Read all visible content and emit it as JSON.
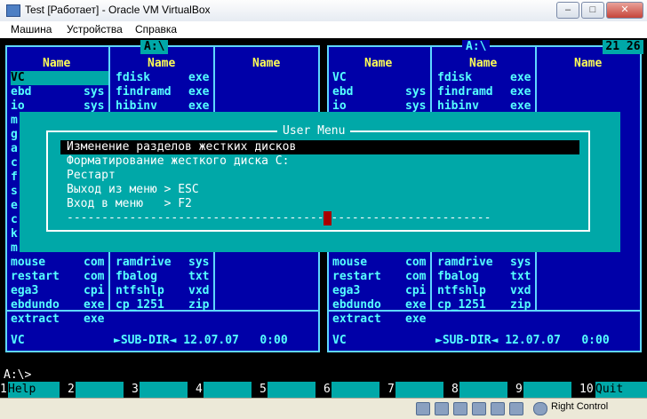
{
  "window": {
    "title": "Test [Работает] - Oracle VM VirtualBox"
  },
  "menubar": [
    "Машина",
    "Устройства",
    "Справка"
  ],
  "clock": "21 26",
  "left_panel": {
    "path": "A:\\",
    "headers": [
      "Name",
      "Name",
      "Name"
    ],
    "col1_top": [
      [
        "VC",
        ""
      ],
      [
        "ebd",
        "sys"
      ],
      [
        "io",
        "sys"
      ]
    ],
    "col1_letters": [
      "m",
      "g",
      "a",
      "c",
      "f",
      "s",
      "e",
      "c",
      "k",
      "m"
    ],
    "col2_top": [
      [
        "fdisk",
        "exe"
      ],
      [
        "findramd",
        "exe"
      ],
      [
        "hibinv",
        "exe"
      ]
    ],
    "col1_bottom": [
      [
        "mouse",
        "com"
      ],
      [
        "restart",
        "com"
      ],
      [
        "ega3",
        "cpi"
      ],
      [
        "ebdundo",
        "exe"
      ],
      [
        "extract",
        "exe"
      ]
    ],
    "col2_bottom": [
      [
        "ramdrive",
        "sys"
      ],
      [
        "fbalog",
        "txt"
      ],
      [
        "ntfshlp",
        "vxd"
      ],
      [
        "cp_1251",
        "zip"
      ]
    ],
    "footer_name": "VC",
    "footer_info": "►SUB-DIR◄ 12.07.07   0:00"
  },
  "right_panel": {
    "path": "A:\\",
    "headers": [
      "Name",
      "Name",
      "Name"
    ],
    "col1_top": [
      [
        "VC",
        ""
      ],
      [
        "ebd",
        "sys"
      ],
      [
        "io",
        "sys"
      ]
    ],
    "col2_top": [
      [
        "fdisk",
        "exe"
      ],
      [
        "findramd",
        "exe"
      ],
      [
        "hibinv",
        "exe"
      ]
    ],
    "col1_bottom": [
      [
        "mouse",
        "com"
      ],
      [
        "restart",
        "com"
      ],
      [
        "ega3",
        "cpi"
      ],
      [
        "ebdundo",
        "exe"
      ],
      [
        "extract",
        "exe"
      ]
    ],
    "col2_bottom": [
      [
        "ramdrive",
        "sys"
      ],
      [
        "fbalog",
        "txt"
      ],
      [
        "ntfshlp",
        "vxd"
      ],
      [
        "cp_1251",
        "zip"
      ]
    ],
    "footer_name": "VC",
    "footer_info": "►SUB-DIR◄ 12.07.07   0:00"
  },
  "user_menu": {
    "title": "User Menu",
    "items": [
      "Изменение разделов жестких дисков",
      "Форматирование жесткого диска C:",
      "Рестарт",
      "Выход из меню > ESC",
      "Вход в меню   > F2"
    ],
    "selected_index": 0,
    "divider": "----------------------------------------------------------------"
  },
  "prompt": "A:\\>",
  "fkeys": [
    {
      "num": "1",
      "label": "Help"
    },
    {
      "num": "2",
      "label": ""
    },
    {
      "num": "3",
      "label": ""
    },
    {
      "num": "4",
      "label": ""
    },
    {
      "num": "5",
      "label": ""
    },
    {
      "num": "6",
      "label": ""
    },
    {
      "num": "7",
      "label": ""
    },
    {
      "num": "8",
      "label": ""
    },
    {
      "num": "9",
      "label": ""
    },
    {
      "num": "10",
      "label": "Quit"
    }
  ],
  "statusbar": {
    "host_key": "Right Control"
  }
}
